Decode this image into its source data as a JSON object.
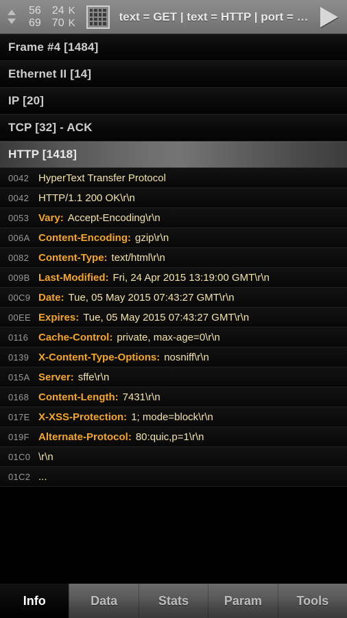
{
  "topbar": {
    "nav_up_icon": "triangle-up-icon",
    "nav_down_icon": "triangle-down-icon",
    "packets_current": "56",
    "packets_total": "69",
    "bytes_current": "24",
    "bytes_current_unit": "K",
    "bytes_total": "70",
    "bytes_total_unit": "K",
    "grid_icon": "grid-icon",
    "filter_expression": "text = GET | text = HTTP | port = ",
    "filter_ellipsis": "…",
    "play_icon": "play-icon"
  },
  "sections": [
    {
      "label": "Frame #4 [1484]",
      "selected": false
    },
    {
      "label": "Ethernet II [14]",
      "selected": false
    },
    {
      "label": "IP [20]",
      "selected": false
    },
    {
      "label": "TCP [32] - ACK",
      "selected": false
    },
    {
      "label": "HTTP [1418]",
      "selected": true
    }
  ],
  "detail_rows": [
    {
      "offset": "0042",
      "name": "",
      "value": "HyperText Transfer Protocol"
    },
    {
      "offset": "0042",
      "name": "",
      "value": "HTTP/1.1 200 OK\\r\\n"
    },
    {
      "offset": "0053",
      "name": "Vary:",
      "value": "Accept-Encoding\\r\\n"
    },
    {
      "offset": "006A",
      "name": "Content-Encoding:",
      "value": "gzip\\r\\n"
    },
    {
      "offset": "0082",
      "name": "Content-Type:",
      "value": "text/html\\r\\n"
    },
    {
      "offset": "009B",
      "name": "Last-Modified:",
      "value": "Fri, 24 Apr 2015 13:19:00 GMT\\r\\n"
    },
    {
      "offset": "00C9",
      "name": "Date:",
      "value": "Tue, 05 May 2015 07:43:27 GMT\\r\\n"
    },
    {
      "offset": "00EE",
      "name": "Expires:",
      "value": "Tue, 05 May 2015 07:43:27 GMT\\r\\n"
    },
    {
      "offset": "0116",
      "name": "Cache-Control:",
      "value": "private, max-age=0\\r\\n"
    },
    {
      "offset": "0139",
      "name": "X-Content-Type-Options:",
      "value": "nosniff\\r\\n"
    },
    {
      "offset": "015A",
      "name": "Server:",
      "value": "sffe\\r\\n"
    },
    {
      "offset": "0168",
      "name": "Content-Length:",
      "value": "7431\\r\\n"
    },
    {
      "offset": "017E",
      "name": "X-XSS-Protection:",
      "value": "1; mode=block\\r\\n"
    },
    {
      "offset": "019F",
      "name": "Alternate-Protocol:",
      "value": "80:quic,p=1\\r\\n"
    },
    {
      "offset": "01C0",
      "name": "",
      "value": "\\r\\n"
    },
    {
      "offset": "01C2",
      "name": "",
      "value": "..."
    }
  ],
  "tabs": [
    {
      "label": "Info",
      "active": true
    },
    {
      "label": "Data",
      "active": false
    },
    {
      "label": "Stats",
      "active": false
    },
    {
      "label": "Param",
      "active": false
    },
    {
      "label": "Tools",
      "active": false
    }
  ],
  "colors": {
    "header_name": "#f5a623",
    "header_value": "#f2e3a8",
    "offset": "#9a9a9a",
    "section_text": "#cfcfcf",
    "topbar_bg": "#7e7e7e",
    "background": "#000000"
  }
}
